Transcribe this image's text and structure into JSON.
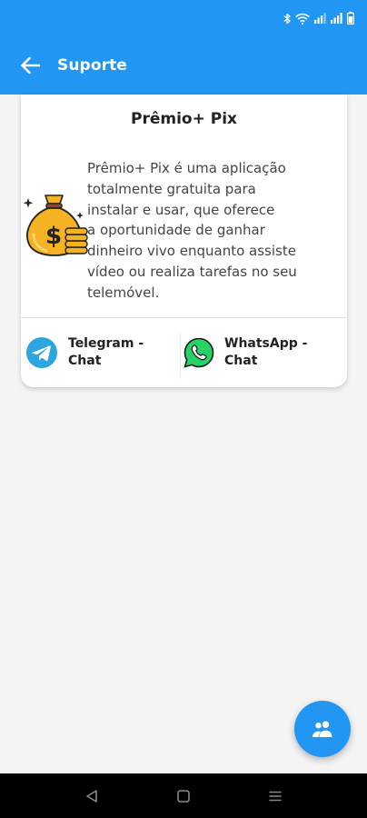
{
  "status_bar": {
    "icons": [
      "bluetooth-icon",
      "wifi-icon",
      "signal-icon",
      "signal-icon",
      "battery-icon"
    ]
  },
  "app_bar": {
    "back_icon": "arrow-left-icon",
    "title": "Suporte"
  },
  "card": {
    "title": "Prêmio+ Pix",
    "image_icon": "money-bag-icon",
    "description_lines": [
      "Prêmio+ Pix é uma aplicação",
      "totalmente gratuita para",
      "instalar e usar, que oferece",
      "a oportunidade de ganhar",
      "dinheiro vivo enquanto assiste",
      "vídeo ou realiza tarefas no seu",
      "telemóvel."
    ]
  },
  "chats": [
    {
      "icon": "telegram-icon",
      "line1": "Telegram -",
      "line2": "Chat",
      "color": "#2ca5e0"
    },
    {
      "icon": "whatsapp-icon",
      "line1": "WhatsApp -",
      "line2": "Chat",
      "color": "#25d366"
    }
  ],
  "fab": {
    "icon": "group-icon"
  },
  "nav_bar": {
    "icons": [
      "nav-back-icon",
      "nav-home-icon",
      "nav-menu-icon"
    ]
  },
  "colors": {
    "primary": "#2196f3",
    "background": "#f4f4f4",
    "card": "#ffffff",
    "text": "#222222"
  }
}
